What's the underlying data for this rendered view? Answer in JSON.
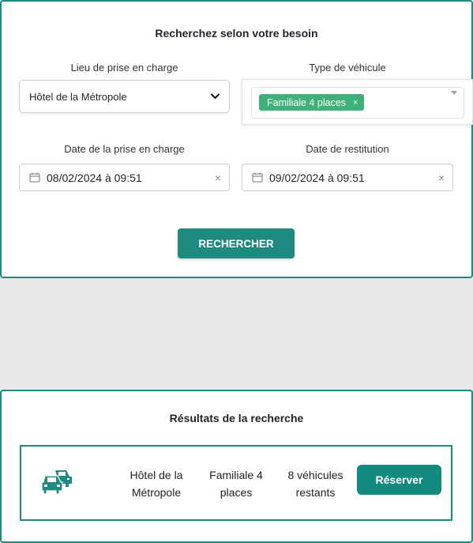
{
  "search": {
    "title": "Recherchez selon votre besoin",
    "pickup_location": {
      "label": "Lieu de prise en charge",
      "value": "Hôtel de la Métropole"
    },
    "vehicle_type": {
      "label": "Type de véhicule",
      "selected_tag": "Familiale 4 places",
      "tag_remove": "×"
    },
    "pickup_date": {
      "label": "Date de la prise en charge",
      "value": "08/02/2024 à 09:51",
      "clear": "×"
    },
    "return_date": {
      "label": "Date de restitution",
      "value": "09/02/2024 à 09:51",
      "clear": "×"
    },
    "button_label": "RECHERCHER"
  },
  "results": {
    "title": "Résultats de la recherche",
    "items": [
      {
        "icon": "cars-icon",
        "location_line1": "Hôtel de la",
        "location_line2": "Métropole",
        "type_line1": "Familiale 4",
        "type_line2": "places",
        "availability_line1": "8 véhicules",
        "availability_line2": "restants",
        "button_label": "Réserver"
      }
    ]
  },
  "colors": {
    "accent": "#1e8a80",
    "tag": "#3fb07a",
    "background": "#e8e9eb"
  }
}
